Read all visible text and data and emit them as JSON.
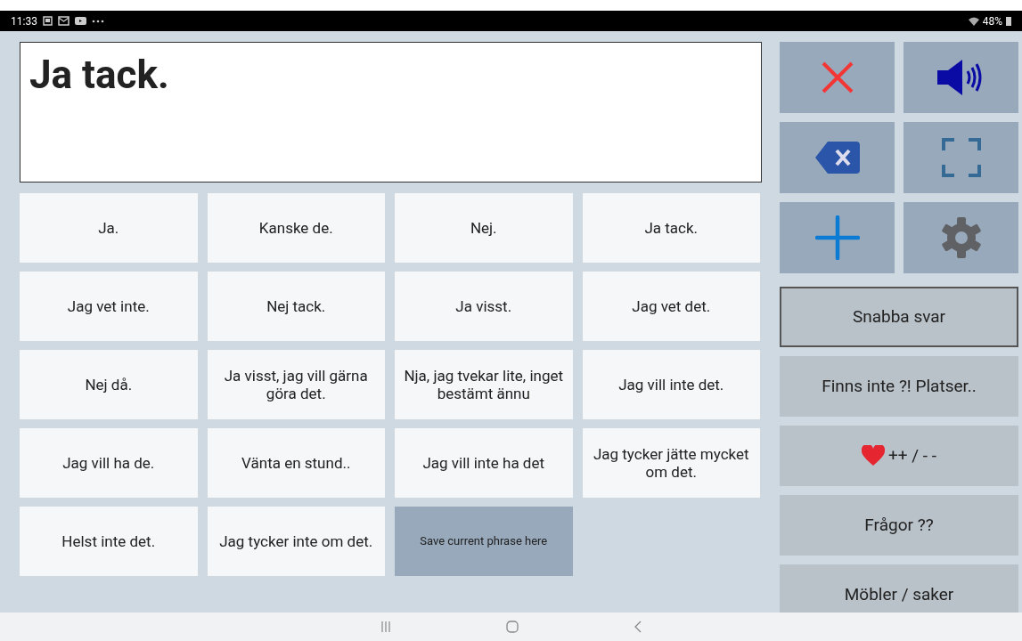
{
  "status_bar": {
    "time": "11:33",
    "battery": "48%"
  },
  "message": {
    "text": "Ja tack."
  },
  "phrases": [
    {
      "kind": "phrase",
      "text": "Ja."
    },
    {
      "kind": "phrase",
      "text": "Kanske de."
    },
    {
      "kind": "phrase",
      "text": "Nej."
    },
    {
      "kind": "phrase",
      "text": "Ja tack."
    },
    {
      "kind": "phrase",
      "text": "Jag vet inte."
    },
    {
      "kind": "phrase",
      "text": "Nej tack."
    },
    {
      "kind": "phrase",
      "text": "Ja visst."
    },
    {
      "kind": "phrase",
      "text": "Jag vet det."
    },
    {
      "kind": "phrase",
      "text": "Nej då."
    },
    {
      "kind": "phrase",
      "text": "Ja visst, jag vill gärna göra det."
    },
    {
      "kind": "phrase",
      "text": "Nja, jag tvekar lite, inget bestämt ännu"
    },
    {
      "kind": "phrase",
      "text": "Jag vill inte det."
    },
    {
      "kind": "phrase",
      "text": "Jag vill ha de."
    },
    {
      "kind": "phrase",
      "text": "Vänta en stund.."
    },
    {
      "kind": "phrase",
      "text": "Jag vill inte ha det"
    },
    {
      "kind": "phrase",
      "text": "Jag tycker jätte mycket om det."
    },
    {
      "kind": "phrase",
      "text": "Helst inte det."
    },
    {
      "kind": "phrase",
      "text": "Jag tycker inte om det."
    },
    {
      "kind": "save",
      "text": "Save current phrase here"
    }
  ],
  "tools": [
    {
      "kind": "clear"
    },
    {
      "kind": "speak"
    },
    {
      "kind": "backspace"
    },
    {
      "kind": "fullscreen"
    },
    {
      "kind": "add"
    },
    {
      "kind": "settings"
    }
  ],
  "categories": [
    {
      "text": "Snabba svar",
      "selected": true
    },
    {
      "text": "Finns inte ?! Platser..",
      "selected": false
    },
    {
      "text": "++ / - -",
      "selected": false,
      "kind": "heart"
    },
    {
      "text": "Frågor ??",
      "selected": false
    },
    {
      "text": "Möbler / saker",
      "selected": false
    }
  ]
}
